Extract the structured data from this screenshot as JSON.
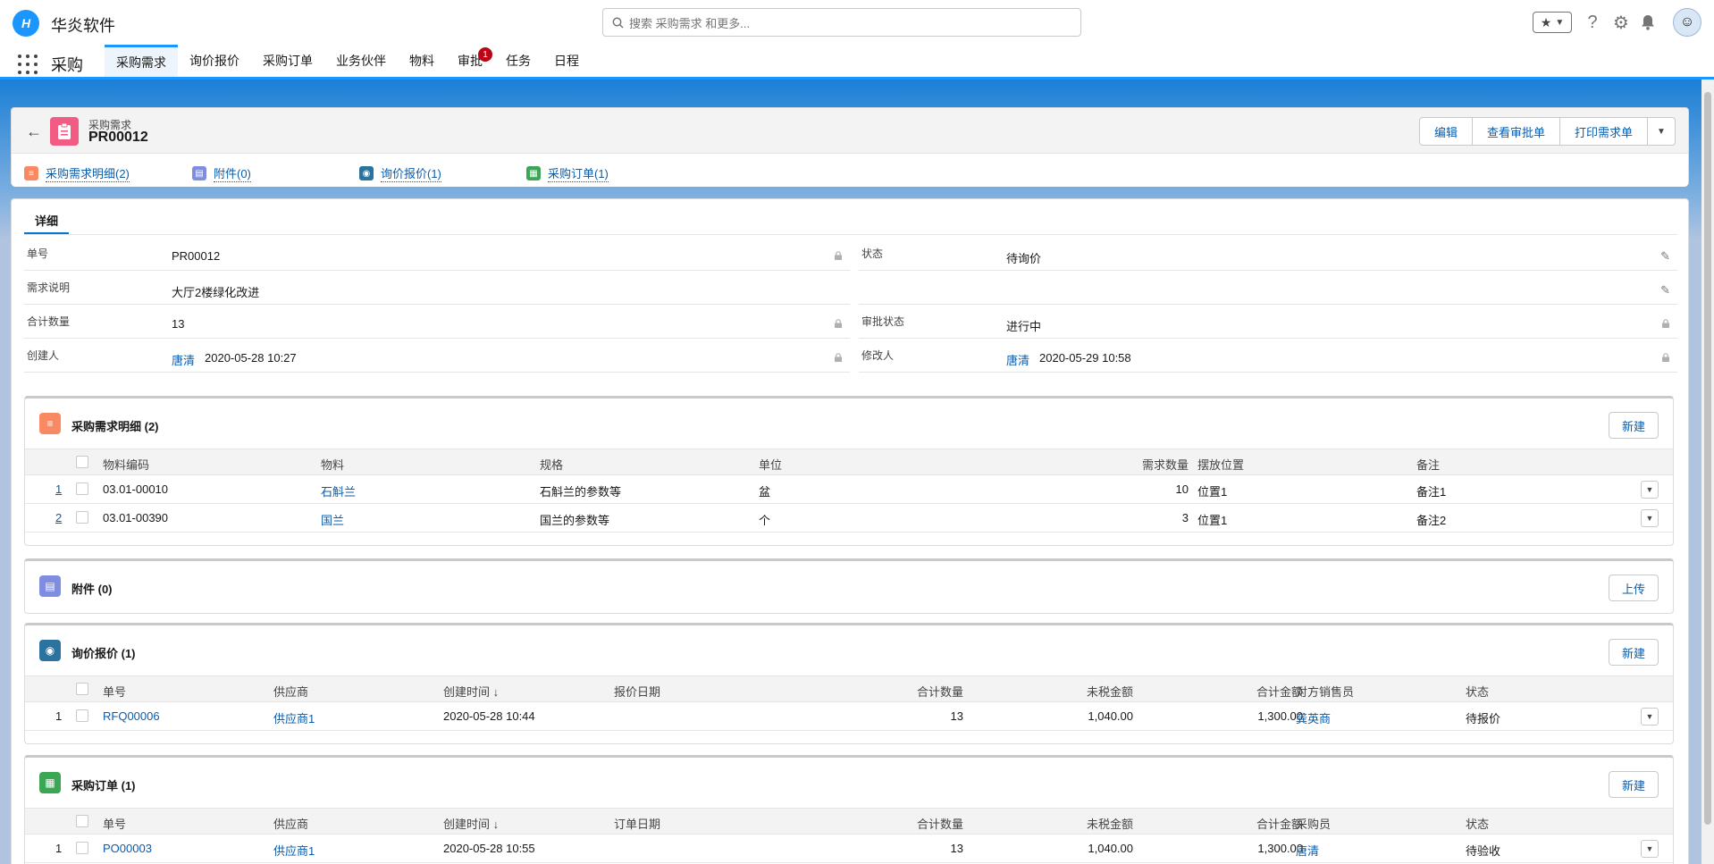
{
  "header": {
    "brand": "华炎软件",
    "search_placeholder": "搜索 采购需求 和更多...",
    "fav_icon": "star-icon",
    "colors": {
      "brand": "#1b96ff"
    }
  },
  "nav": {
    "app_name": "采购",
    "tabs": [
      {
        "label": "采购需求",
        "active": true
      },
      {
        "label": "询价报价"
      },
      {
        "label": "采购订单"
      },
      {
        "label": "业务伙伴"
      },
      {
        "label": "物料"
      },
      {
        "label": "审批",
        "badge": "1"
      },
      {
        "label": "任务"
      },
      {
        "label": "日程"
      }
    ]
  },
  "record": {
    "type": "采购需求",
    "title": "PR00012",
    "actions": [
      "编辑",
      "查看审批单",
      "打印需求单"
    ],
    "related_links": [
      "采购需求明细(2)",
      "附件(0)",
      "询价报价(1)",
      "采购订单(1)"
    ]
  },
  "detail": {
    "tab": "详细",
    "fields": {
      "no_label": "单号",
      "no_value": "PR00012",
      "status_label": "状态",
      "status_value": "待询价",
      "desc_label": "需求说明",
      "desc_value": "大厅2楼绿化改进",
      "qty_label": "合计数量",
      "qty_value": "13",
      "approval_label": "审批状态",
      "approval_value": "进行中",
      "creator_label": "创建人",
      "creator_name": "唐清",
      "creator_time": "2020-05-28 10:27",
      "modifier_label": "修改人",
      "modifier_name": "唐清",
      "modifier_time": "2020-05-29 10:58"
    }
  },
  "lines": {
    "title": "采购需求明细 (2)",
    "button": "新建",
    "columns": [
      "物料编码",
      "物料",
      "规格",
      "单位",
      "需求数量",
      "摆放位置",
      "备注"
    ],
    "rows": [
      {
        "idx": "1",
        "code": "03.01-00010",
        "material": "石斛兰",
        "spec": "石斛兰的参数等",
        "unit": "盆",
        "qty": "10",
        "place": "位置1",
        "note": "备注1"
      },
      {
        "idx": "2",
        "code": "03.01-00390",
        "material": "国兰",
        "spec": "国兰的参数等",
        "unit": "个",
        "qty": "3",
        "place": "位置1",
        "note": "备注2"
      }
    ]
  },
  "attachments": {
    "title": "附件 (0)",
    "button": "上传"
  },
  "rfq": {
    "title": "询价报价 (1)",
    "button": "新建",
    "columns": [
      "单号",
      "供应商",
      "创建时间 ↓",
      "报价日期",
      "合计数量",
      "未税金额",
      "合计金额",
      "对方销售员",
      "状态"
    ],
    "rows": [
      {
        "idx": "1",
        "no": "RFQ00006",
        "supplier": "供应商1",
        "created": "2020-05-28 10:44",
        "date": "",
        "qty": "13",
        "net": "1,040.00",
        "total": "1,300.00",
        "person": "龚英商",
        "status": "待报价"
      }
    ]
  },
  "po": {
    "title": "采购订单 (1)",
    "button": "新建",
    "columns": [
      "单号",
      "供应商",
      "创建时间 ↓",
      "订单日期",
      "合计数量",
      "未税金额",
      "合计金额",
      "采购员",
      "状态"
    ],
    "rows": [
      {
        "idx": "1",
        "no": "PO00003",
        "supplier": "供应商1",
        "created": "2020-05-28 10:55",
        "date": "",
        "qty": "13",
        "net": "1,040.00",
        "total": "1,300.00",
        "person": "唐清",
        "status": "待验收"
      }
    ]
  }
}
